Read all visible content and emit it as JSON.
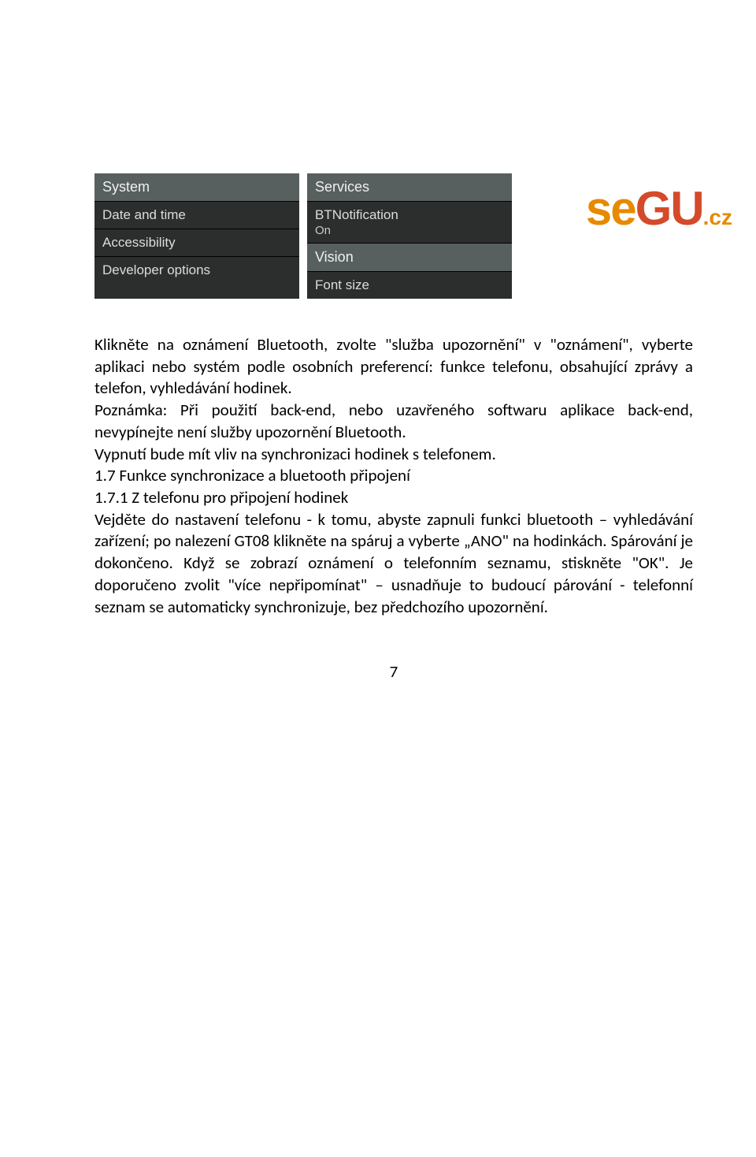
{
  "logo": {
    "part1": "se",
    "part2": "GU",
    "suffix": ".cz"
  },
  "panels": {
    "left": {
      "header": "System",
      "rows": [
        {
          "main": "Date and time"
        },
        {
          "main": "Accessibility"
        },
        {
          "main": "Developer options"
        }
      ]
    },
    "right": {
      "headerA": "Services",
      "rowA": {
        "main": "BTNotification",
        "sub": "On"
      },
      "headerB": "Vision",
      "rowB": {
        "main": "Font size"
      }
    }
  },
  "body": {
    "p1": "Klikněte na oznámení Bluetooth, zvolte \"služba upozornění\" v \"oznámení\", vyberte aplikaci nebo systém podle osobních preferencí: funkce telefonu, obsahující zprávy a telefon, vyhledávání hodinek.",
    "p2": "Poznámka: Při použití back-end, nebo uzavřeného softwaru aplikace back-end, nevypínejte není služby upozornění Bluetooth.",
    "p3": "Vypnutí bude mít vliv na synchronizaci hodinek s telefonem.",
    "p4": "1.7 Funkce synchronizace a bluetooth připojení",
    "p5": "1.7.1 Z telefonu pro připojení hodinek",
    "p6": "Vejděte do nastavení telefonu - k tomu, abyste zapnuli funkci bluetooth – vyhledávání zařízení; po nalezení GT08 klikněte na spáruj a vyberte „ANO\" na hodinkách. Spárování je dokončeno. Když se zobrazí oznámení o telefonním seznamu, stiskněte \"OK\". Je doporučeno zvolit \"více nepřipomínat\" – usnadňuje to budoucí párování - telefonní seznam se automaticky synchronizuje, bez předchozího upozornění."
  },
  "pageNumber": "7"
}
